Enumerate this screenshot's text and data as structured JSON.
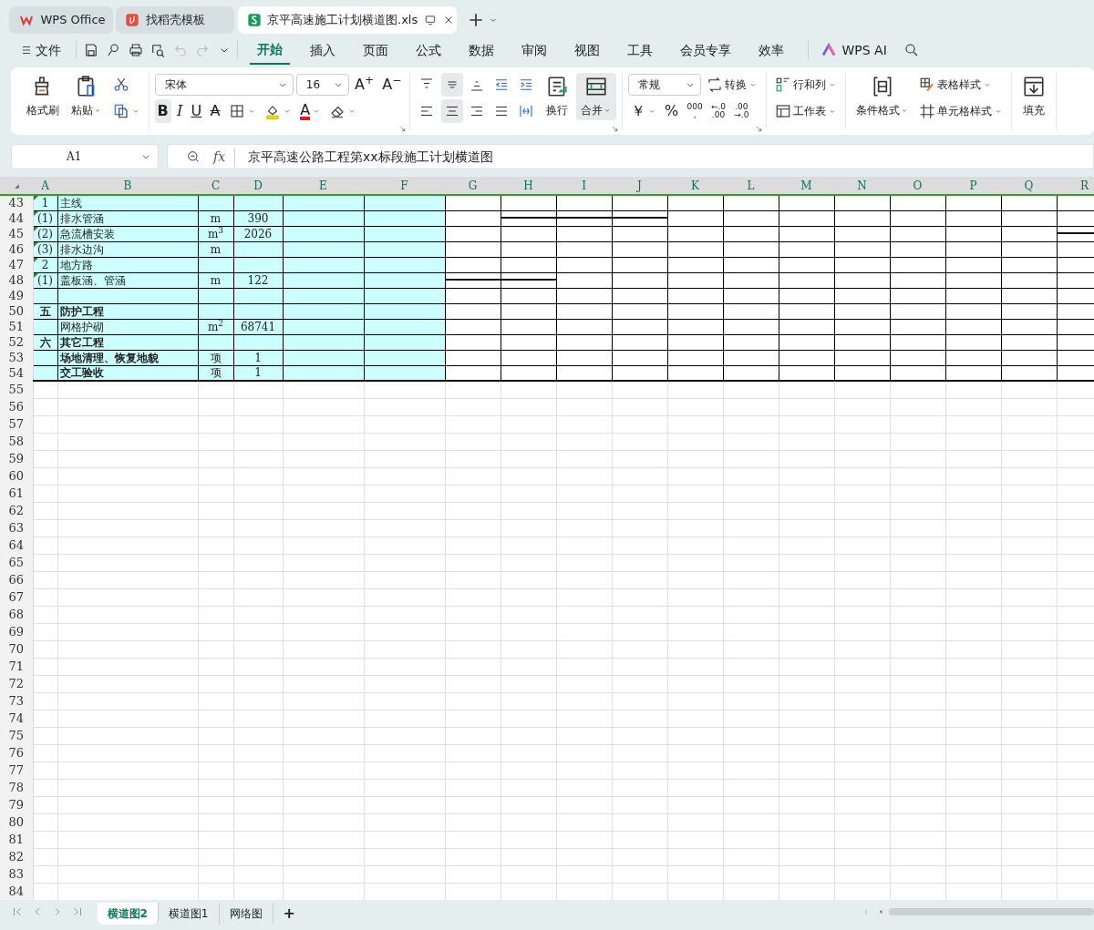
{
  "app_tabs": [
    {
      "kind": "home",
      "label": "WPS Office",
      "selected": false
    },
    {
      "kind": "template",
      "label": "找稻壳模板",
      "selected": false
    },
    {
      "kind": "file",
      "label": "京平高速施工计划横道图.xls",
      "selected": true
    }
  ],
  "menu": {
    "file": "文件",
    "tabs": [
      {
        "label": "开始",
        "selected": true
      },
      {
        "label": "插入",
        "selected": false
      },
      {
        "label": "页面",
        "selected": false
      },
      {
        "label": "公式",
        "selected": false
      },
      {
        "label": "数据",
        "selected": false
      },
      {
        "label": "审阅",
        "selected": false
      },
      {
        "label": "视图",
        "selected": false
      },
      {
        "label": "工具",
        "selected": false
      },
      {
        "label": "会员专享",
        "selected": false
      },
      {
        "label": "效率",
        "selected": false
      }
    ],
    "ai": "WPS AI"
  },
  "ribbon": [
    {
      "blocks": [
        {
          "kind": "big",
          "label": "格式刷",
          "dropdown": false,
          "pressed": false
        },
        {
          "kind": "big",
          "label": "粘贴",
          "dropdown": true,
          "pressed": false
        },
        {
          "kind": "stack",
          "top": [
            {
              "kind": "tool",
              "dropdown": false,
              "pressed": false
            }
          ],
          "bottom": [
            {
              "kind": "tool",
              "dropdown": true,
              "pressed": false
            }
          ]
        }
      ]
    },
    {
      "blocks": [
        {
          "kind": "stack",
          "top": [
            {
              "kind": "select",
              "value": "宋体"
            },
            {
              "kind": "select",
              "value": "16"
            },
            {
              "kind": "glyph",
              "label": "A$^{+}$",
              "dropdown": false,
              "pressed": false
            },
            {
              "kind": "glyph",
              "label": "A$^{−}$",
              "dropdown": false,
              "pressed": false
            }
          ],
          "bottom": [
            {
              "kind": "bold",
              "label": "B",
              "dropdown": false,
              "pressed": true
            },
            {
              "kind": "italic",
              "label": "I",
              "dropdown": false,
              "pressed": false
            },
            {
              "kind": "underline",
              "label": "U",
              "dropdown": false,
              "pressed": false
            },
            {
              "kind": "strike",
              "label": "A",
              "dropdown": false,
              "pressed": false
            },
            {
              "kind": "tool",
              "dropdown": true,
              "pressed": false
            },
            {
              "kind": "tool",
              "dropdown": true,
              "pressed": false
            },
            {
              "kind": "fontcolor",
              "label": "A",
              "dropdown": true,
              "pressed": false
            },
            {
              "kind": "tool",
              "dropdown": true,
              "pressed": false
            }
          ]
        },
        {
          "kind": "launcher"
        }
      ]
    },
    {
      "blocks": [
        {
          "kind": "stack",
          "top": [
            {
              "kind": "tool",
              "dropdown": false,
              "pressed": false
            },
            {
              "kind": "tool",
              "dropdown": false,
              "pressed": true
            },
            {
              "kind": "tool",
              "dropdown": false,
              "pressed": false
            },
            {
              "kind": "tool",
              "dropdown": false,
              "pressed": false
            },
            {
              "kind": "tool",
              "dropdown": false,
              "pressed": false
            }
          ],
          "bottom": [
            {
              "kind": "tool",
              "dropdown": false,
              "pressed": false
            },
            {
              "kind": "tool",
              "dropdown": false,
              "pressed": true
            },
            {
              "kind": "tool",
              "dropdown": false,
              "pressed": false
            },
            {
              "kind": "tool",
              "dropdown": false,
              "pressed": false
            },
            {
              "kind": "tool",
              "dropdown": false,
              "pressed": false
            }
          ]
        },
        {
          "kind": "big",
          "label": "换行",
          "dropdown": false,
          "pressed": false
        },
        {
          "kind": "big",
          "label": "合并",
          "dropdown": true,
          "pressed": true
        },
        {
          "kind": "launcher"
        }
      ]
    },
    {
      "blocks": [
        {
          "kind": "stack",
          "top": [
            {
              "kind": "select",
              "value": "常规"
            },
            {
              "kind": "tool",
              "label": "转换",
              "dropdown": true,
              "pressed": false
            }
          ],
          "bottom": [
            {
              "kind": "glyph",
              "label": "￥",
              "dropdown": true,
              "pressed": false
            },
            {
              "kind": "glyph",
              "label": "%",
              "dropdown": false,
              "pressed": false
            },
            {
              "kind": "decimal",
              "lines": [
                "000",
                ","
              ],
              "dropdown": false,
              "pressed": false
            },
            {
              "kind": "decimal",
              "lines": [
                "←.0",
                ".00"
              ],
              "dropdown": false,
              "pressed": false
            },
            {
              "kind": "decimal",
              "lines": [
                ".00",
                "→.0"
              ],
              "dropdown": false,
              "pressed": false
            }
          ]
        },
        {
          "kind": "launcher"
        }
      ]
    },
    {
      "blocks": [
        {
          "kind": "stack",
          "top": [
            {
              "kind": "tool",
              "label": "行和列",
              "dropdown": true,
              "pressed": false
            }
          ],
          "bottom": [
            {
              "kind": "tool",
              "label": "工作表",
              "dropdown": true,
              "pressed": false
            }
          ]
        }
      ]
    },
    {
      "blocks": [
        {
          "kind": "big",
          "label": "条件格式",
          "dropdown": true,
          "pressed": false
        },
        {
          "kind": "stack",
          "top": [
            {
              "kind": "tool",
              "label": "表格样式",
              "dropdown": true,
              "pressed": false
            }
          ],
          "bottom": [
            {
              "kind": "tool",
              "label": "单元格样式",
              "dropdown": true,
              "pressed": false
            }
          ]
        }
      ]
    },
    {
      "blocks": [
        {
          "kind": "big",
          "label": "填充",
          "dropdown": false,
          "pressed": false
        }
      ]
    }
  ],
  "formula_bar": {
    "cell": "A1",
    "fx": "fx",
    "content": "京平高速公路工程第xx标段施工计划横道图"
  },
  "sheet": {
    "columns": [
      "A",
      "B",
      "C",
      "D",
      "E",
      "F",
      "G",
      "H",
      "I",
      "J",
      "K",
      "L",
      "M",
      "N",
      "O",
      "P",
      "Q",
      "R"
    ],
    "rows": [
      {
        "num": "43",
        "marker": true,
        "bold": false,
        "a": "1",
        "b": "主线"
      },
      {
        "num": "44",
        "marker": true,
        "bold": false,
        "a": "(1)",
        "b": "排水管涵",
        "c": "m",
        "d": "390",
        "gantt": [
          false,
          true,
          true,
          true,
          false,
          false,
          false,
          false,
          false,
          false,
          false,
          false
        ]
      },
      {
        "num": "45",
        "marker": true,
        "bold": false,
        "a": "(2)",
        "b": "急流槽安装",
        "c": "m$^{3}$",
        "d": "2026",
        "gantt": [
          false,
          false,
          false,
          false,
          false,
          false,
          false,
          false,
          false,
          false,
          false,
          true
        ]
      },
      {
        "num": "46",
        "marker": true,
        "bold": false,
        "a": "(3)",
        "b": "排水边沟",
        "c": "m"
      },
      {
        "num": "47",
        "marker": true,
        "bold": false,
        "a": "2",
        "b": "地方路"
      },
      {
        "num": "48",
        "marker": true,
        "bold": false,
        "a": "(1)",
        "b": "盖板涵、管涵",
        "c": "m",
        "d": "122",
        "gantt": [
          true,
          true,
          false,
          false,
          false,
          false,
          false,
          false,
          false,
          false,
          false,
          false
        ]
      },
      {
        "num": "49",
        "marker": false
      },
      {
        "num": "50",
        "marker": false,
        "bold": true,
        "a": "五",
        "b": "防护工程"
      },
      {
        "num": "51",
        "marker": false,
        "bold": false,
        "b": "网格护砌",
        "c": "m$^{2}$",
        "d": "68741"
      },
      {
        "num": "52",
        "marker": false,
        "bold": true,
        "a": "六",
        "b": "其它工程"
      },
      {
        "num": "53",
        "marker": false,
        "bold": true,
        "b": "场地清理、恢复地貌",
        "c": "项",
        "d": "1"
      },
      {
        "num": "54",
        "marker": false,
        "bold": true,
        "b": "交工验收",
        "c": "项",
        "d": "1"
      }
    ],
    "empty_rows": [
      "55",
      "56",
      "57",
      "58",
      "59",
      "60",
      "61",
      "62",
      "63",
      "64",
      "65",
      "66",
      "67",
      "68",
      "69",
      "70",
      "71",
      "72",
      "73",
      "74",
      "75",
      "76",
      "77",
      "78",
      "79",
      "80",
      "81",
      "82",
      "83",
      "84"
    ]
  },
  "sheet_tabs": [
    {
      "label": "横道图2",
      "selected": true
    },
    {
      "label": "横道图1",
      "selected": false
    },
    {
      "label": "网络图",
      "selected": false
    }
  ],
  "add_sheet": "+"
}
